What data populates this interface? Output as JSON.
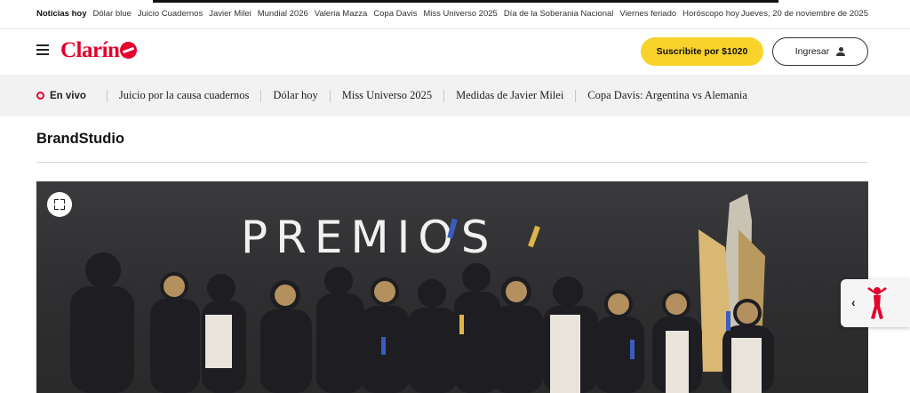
{
  "trending": {
    "items": [
      "Noticias hoy",
      "Dólar blue",
      "Juicio Cuadernos",
      "Javier Milei",
      "Mundial 2026",
      "Valeria Mazza",
      "Copa Davis",
      "Miss Universo 2025",
      "Día de la Soberania Nacional",
      "Viernes feriado",
      "Horóscopo hoy"
    ],
    "date": "Jueves, 20 de noviembre de 2025"
  },
  "header": {
    "logo_text": "Clarín",
    "subscribe_label": "Suscribite por $1020",
    "login_label": "Ingresar",
    "brand_color": "#e5002b",
    "accent_color": "#f9d32b"
  },
  "live": {
    "label": "En vivo",
    "items": [
      "Juicio por la causa cuadernos",
      "Dólar hoy",
      "Miss Universo 2025",
      "Medidas de Javier Milei",
      "Copa Davis: Argentina vs Alemania"
    ]
  },
  "section": {
    "title": "BrandStudio"
  },
  "photo": {
    "headline": "PREMIOS"
  },
  "icons": {
    "menu": "hamburger-menu-icon",
    "user": "user-icon",
    "expand": "expand-icon",
    "side": "chevron-left-icon"
  }
}
